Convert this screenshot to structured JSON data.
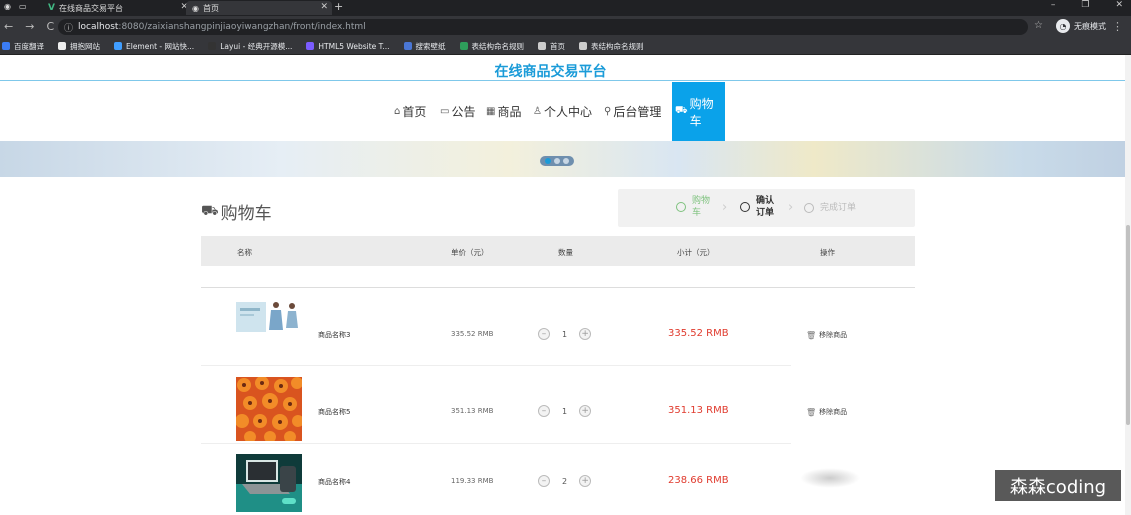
{
  "browser": {
    "tabs": [
      {
        "label": "在线商品交易平台"
      },
      {
        "label": "首页"
      }
    ],
    "url_host": "localhost",
    "url_path": ":8080/zaixianshangpinjiaoyiwangzhan/front/index.html",
    "incognito_label": "无痕模式",
    "bookmarks": [
      {
        "label": "百度翻译",
        "color": "#3b7cf4"
      },
      {
        "label": "拥抱网站",
        "color": "#eeeeee"
      },
      {
        "label": "Element - 网站快...",
        "color": "#409eff"
      },
      {
        "label": "Layui - 经典开源模...",
        "color": "#333333"
      },
      {
        "label": "HTML5 Website T...",
        "color": "#7b5cff"
      },
      {
        "label": "搜索壁纸",
        "color": "#4a76d4"
      },
      {
        "label": "表结构命名规则",
        "color": "#2e9e5b"
      },
      {
        "label": "首页",
        "color": "#cccccc"
      },
      {
        "label": "表结构命名规则",
        "color": "#cccccc"
      }
    ]
  },
  "site": {
    "title": "在线商品交易平台",
    "nav": [
      {
        "label": "首页",
        "icon": "home-icon",
        "glyph": "⌂"
      },
      {
        "label": "公告",
        "icon": "notice-icon",
        "glyph": "▭"
      },
      {
        "label": "商品",
        "icon": "grid-icon",
        "glyph": "▦"
      },
      {
        "label": "个人中心",
        "icon": "user-icon",
        "glyph": "♙"
      },
      {
        "label": "后台管理",
        "icon": "link-icon",
        "glyph": "⚲"
      },
      {
        "label": "购物车",
        "icon": "cart-icon",
        "glyph": "⛟"
      }
    ],
    "active_nav_color": "#0aa2ea"
  },
  "cart": {
    "title": "购物车",
    "steps": [
      {
        "label": "购物车",
        "state": "done"
      },
      {
        "label": "确认订单",
        "state": "current"
      },
      {
        "label": "完成订单",
        "state": "pending"
      }
    ],
    "columns": [
      "名称",
      "单价（元）",
      "数量",
      "小计（元）",
      "操作"
    ],
    "items": [
      {
        "name": "商品名称3",
        "price": "335.52 RMB",
        "qty": "1",
        "subtotal": "335.52 RMB",
        "action": "移除商品"
      },
      {
        "name": "商品名称5",
        "price": "351.13 RMB",
        "qty": "1",
        "subtotal": "351.13 RMB",
        "action": "移除商品"
      },
      {
        "name": "商品名称4",
        "price": "119.33 RMB",
        "qty": "2",
        "subtotal": "238.66 RMB",
        "action": ""
      }
    ]
  },
  "watermark": "森森coding"
}
